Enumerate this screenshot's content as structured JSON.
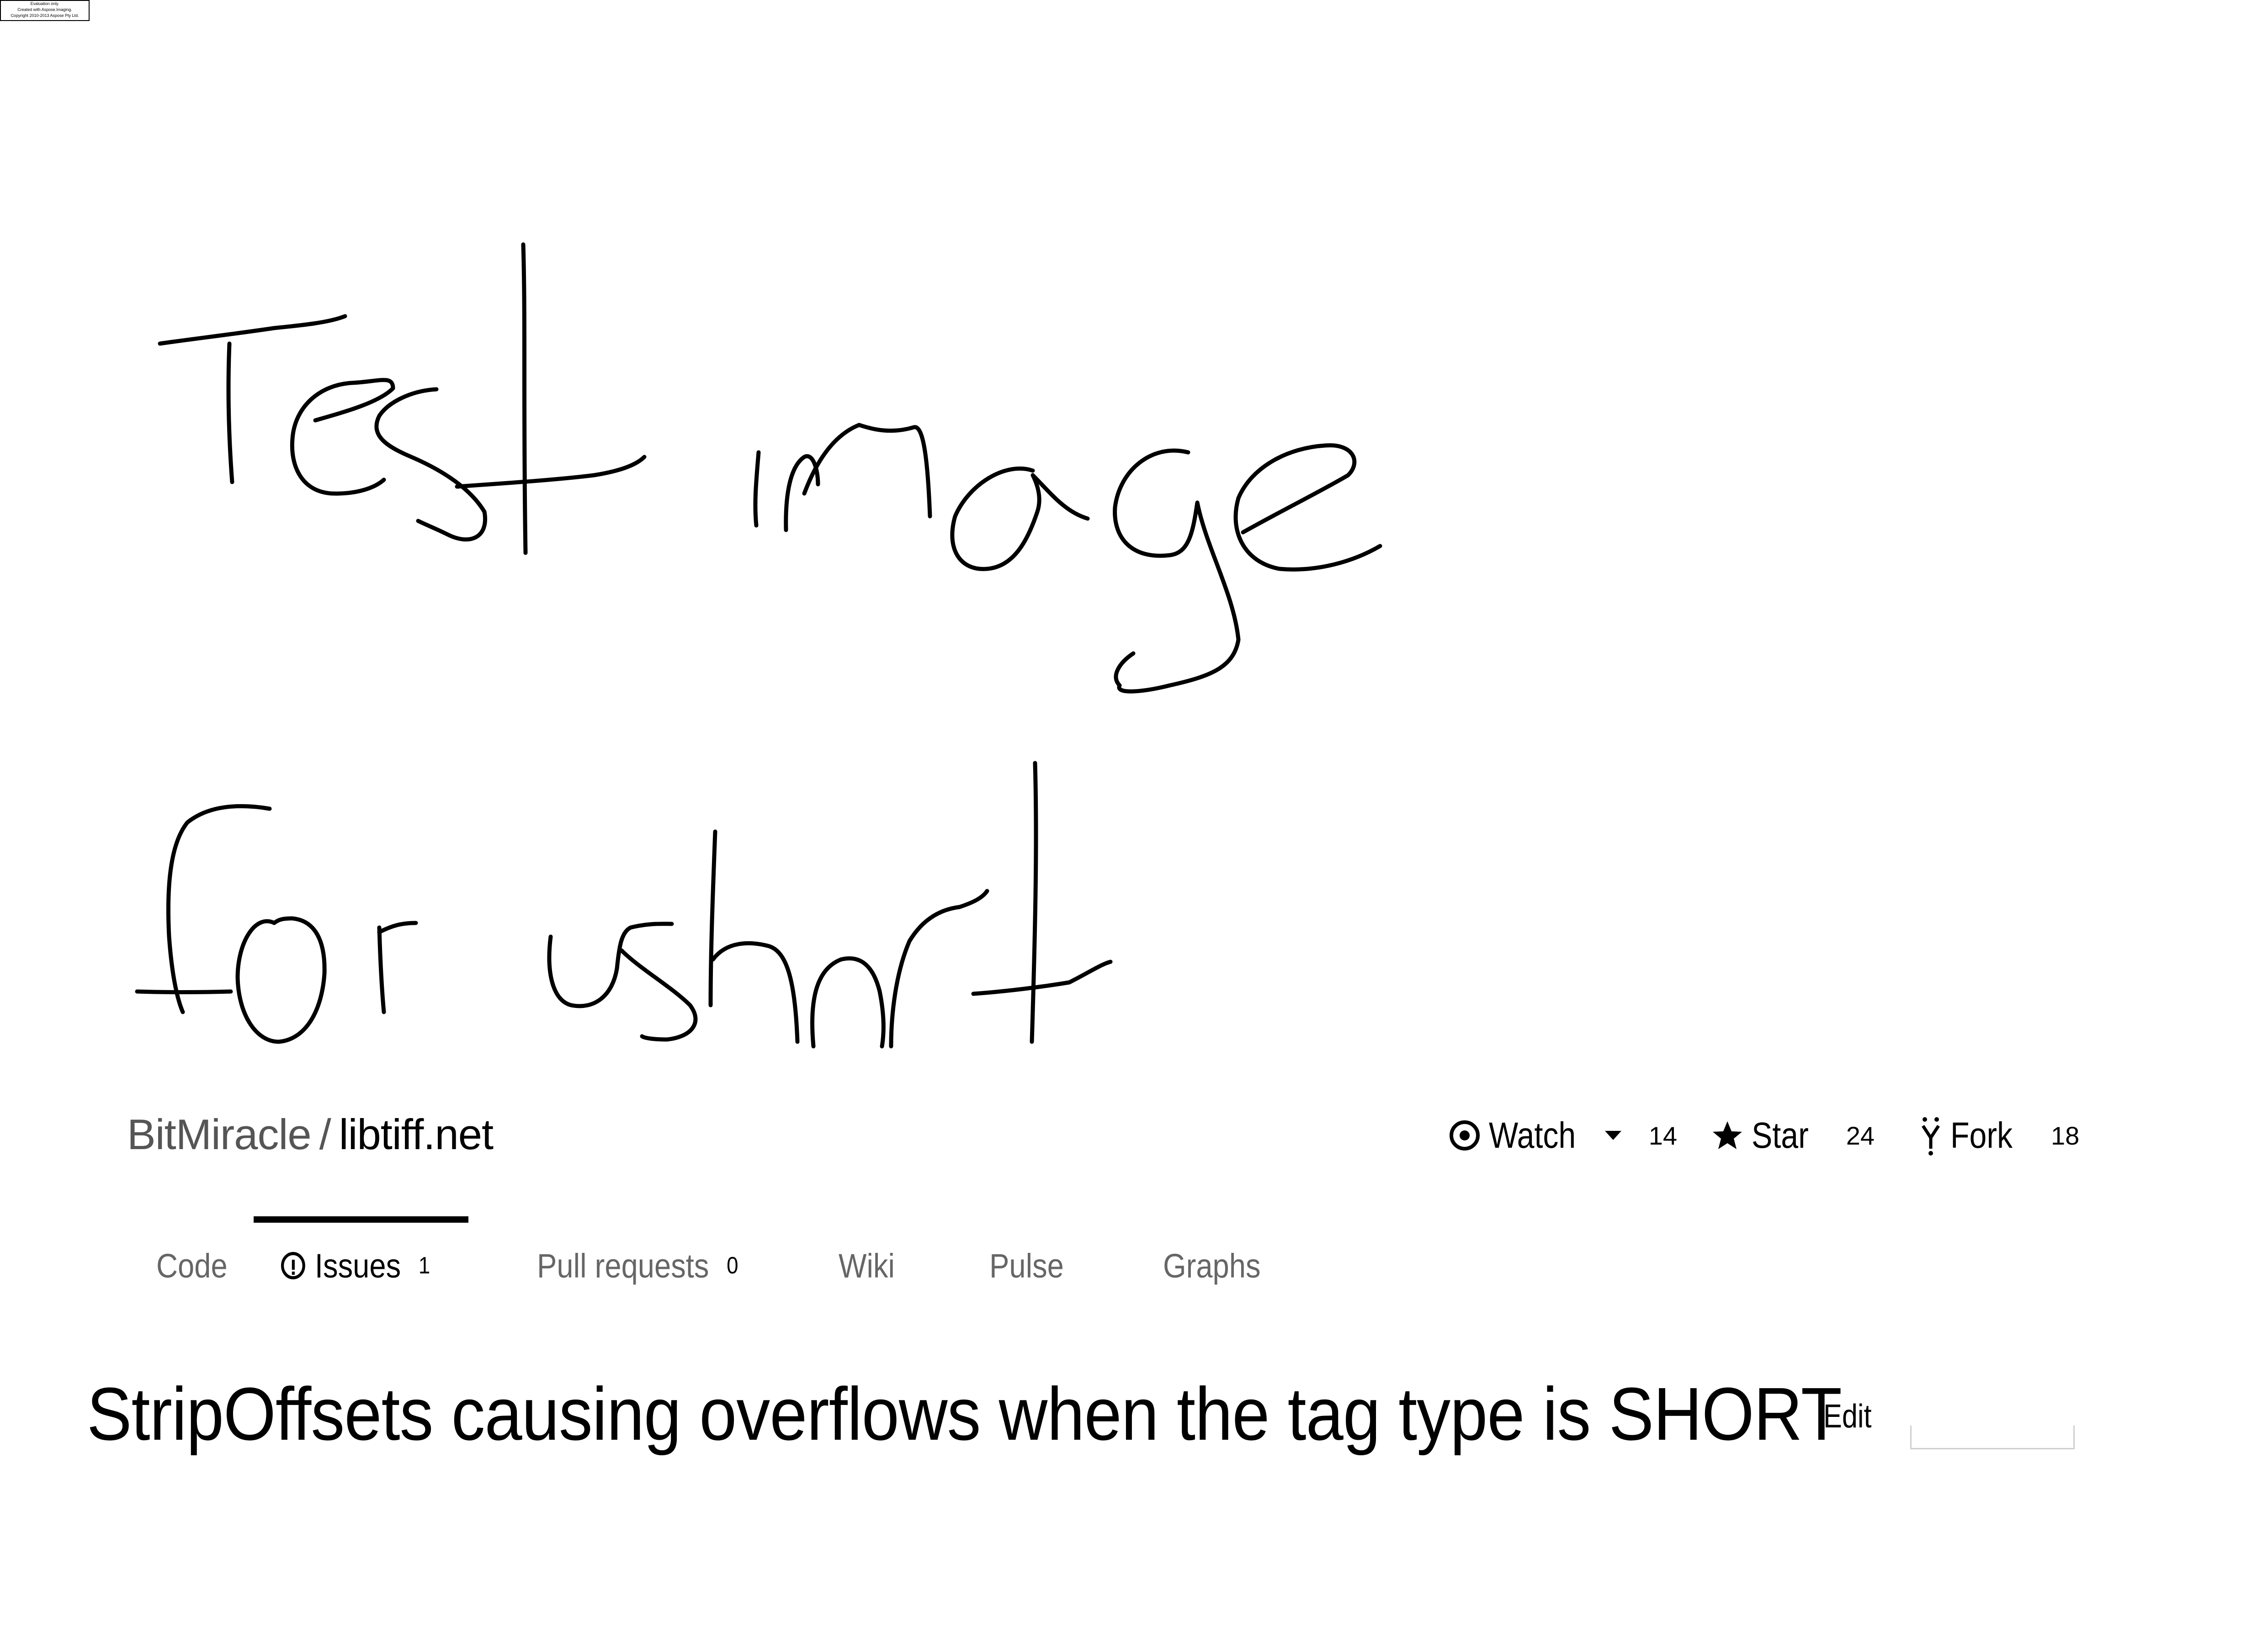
{
  "watermark": {
    "lines": [
      "Evaluation only.",
      "Created with Aspose.Imaging.",
      "Copyright 2010-2013 Aspose Pty Ltd."
    ]
  },
  "repo": {
    "owner": "BitMiracle",
    "separator": "/",
    "name": "libtiff.net"
  },
  "actions": {
    "watch": {
      "label": "Watch",
      "count": "14",
      "icon": "eye-icon"
    },
    "star": {
      "label": "Star",
      "count": "24",
      "icon": "star-icon"
    },
    "fork": {
      "label": "Fork",
      "count": "18",
      "icon": "fork-icon"
    }
  },
  "tabs": {
    "code": {
      "label": "Code"
    },
    "issues": {
      "label": "Issues",
      "count": "1",
      "icon": "issue-opened-icon"
    },
    "pull_requests": {
      "label": "Pull requests",
      "count": "0"
    },
    "wiki": {
      "label": "Wiki"
    },
    "pulse": {
      "label": "Pulse"
    },
    "graphs": {
      "label": "Graphs"
    }
  },
  "issue": {
    "title": "StripOffsets causing overflows when the tag type is SHORT",
    "edit_label": "Edit"
  },
  "colors": {
    "text": "#000000",
    "muted": "#555555",
    "background": "#ffffff"
  }
}
